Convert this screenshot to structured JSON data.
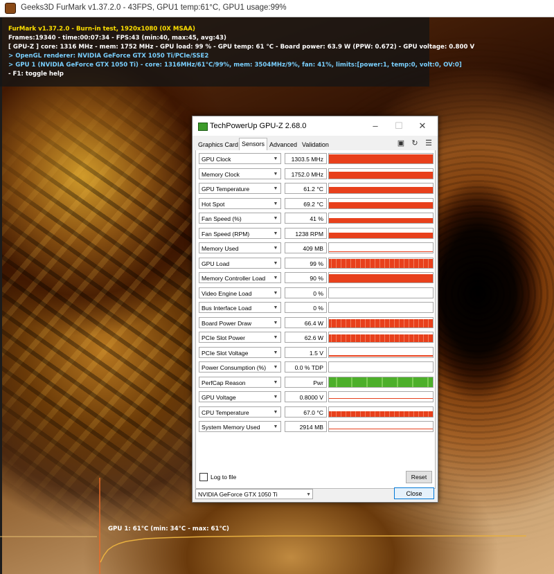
{
  "furmark": {
    "window_title": "Geeks3D FurMark v1.37.2.0 - 43FPS, GPU1 temp:61°C, GPU1 usage:99%",
    "osd": [
      {
        "text": "FurMark v1.37.2.0 - Burn-in test, 1920x1080 (0X MSAA)",
        "color": "yellow"
      },
      {
        "text": "Frames:19340 - time:00:07:34 - FPS:43 (min:40, max:45, avg:43)",
        "color": "white"
      },
      {
        "text": "[ GPU-Z ] core: 1316 MHz - mem: 1752 MHz - GPU load: 99 % - GPU temp: 61 °C - Board power: 63.9 W (PPW: 0.672) - GPU voltage: 0.800 V",
        "color": "white"
      },
      {
        "text": "> OpenGL renderer: NVIDIA GeForce GTX 1050 Ti/PCIe/SSE2",
        "color": "cyan"
      },
      {
        "text": "> GPU 1 (NVIDIA GeForce GTX 1050 Ti) - core: 1316MHz/61°C/99%, mem: 3504MHz/9%, fan: 41%, limits:[power:1, temp:0, volt:0, OV:0]",
        "color": "cyan"
      },
      {
        "text": "- F1: toggle help",
        "color": "white"
      }
    ],
    "graph_label": "GPU 1: 61°C (min: 34°C - max: 61°C)"
  },
  "gpuz": {
    "title": "TechPowerUp GPU-Z 2.68.0",
    "tabs": [
      {
        "label": "Graphics Card",
        "active": false
      },
      {
        "label": "Sensors",
        "active": true
      },
      {
        "label": "Advanced",
        "active": false
      },
      {
        "label": "Validation",
        "active": false
      }
    ],
    "sensors": [
      {
        "name": "GPU Clock",
        "value": "1303.5 MHz",
        "level": 0.92,
        "color": "#e8401c",
        "style": "solid"
      },
      {
        "name": "Memory Clock",
        "value": "1752.0 MHz",
        "level": 0.72,
        "color": "#e8401c",
        "style": "solid"
      },
      {
        "name": "GPU Temperature",
        "value": "61.2 °C",
        "level": 0.62,
        "color": "#e8401c",
        "style": "solid"
      },
      {
        "name": "Hot Spot",
        "value": "69.2 °C",
        "level": 0.66,
        "color": "#e8401c",
        "style": "solid"
      },
      {
        "name": "Fan Speed (%)",
        "value": "41 %",
        "level": 0.5,
        "color": "#e8401c",
        "style": "solid"
      },
      {
        "name": "Fan Speed (RPM)",
        "value": "1238 RPM",
        "level": 0.55,
        "color": "#e8401c",
        "style": "solid"
      },
      {
        "name": "Memory Used",
        "value": "409 MB",
        "level": 0.1,
        "color": "#e8401c",
        "style": "line"
      },
      {
        "name": "GPU Load",
        "value": "99 %",
        "level": 0.95,
        "color": "#e8401c",
        "style": "noisy"
      },
      {
        "name": "Memory Controller Load",
        "value": "90 %",
        "level": 0.85,
        "color": "#e8401c",
        "style": "solid"
      },
      {
        "name": "Video Engine Load",
        "value": "0 %",
        "level": 0,
        "color": "#e8401c",
        "style": "none"
      },
      {
        "name": "Bus Interface Load",
        "value": "0 %",
        "level": 0,
        "color": "#e8401c",
        "style": "none"
      },
      {
        "name": "Board Power Draw",
        "value": "66.4 W",
        "level": 0.85,
        "color": "#e8401c",
        "style": "noisy"
      },
      {
        "name": "PCIe Slot Power",
        "value": "62.6 W",
        "level": 0.8,
        "color": "#e8401c",
        "style": "noisy"
      },
      {
        "name": "PCIe Slot Voltage",
        "value": "1.5 V",
        "level": 0.04,
        "color": "#e8401c",
        "style": "line"
      },
      {
        "name": "Power Consumption (%)",
        "value": "0.0 % TDP",
        "level": 0,
        "color": "#e8401c",
        "style": "none"
      },
      {
        "name": "PerfCap Reason",
        "value": "Pwr",
        "level": 1,
        "color": "#4caf2a",
        "style": "solid"
      },
      {
        "name": "GPU Voltage",
        "value": "0.8000 V",
        "level": 0.25,
        "color": "#e8401c",
        "style": "line"
      },
      {
        "name": "CPU Temperature",
        "value": "67.0 °C",
        "level": 0.6,
        "color": "#e8401c",
        "style": "noisy"
      },
      {
        "name": "System Memory Used",
        "value": "2914 MB",
        "level": 0.18,
        "color": "#e8401c",
        "style": "line"
      }
    ],
    "log_label": "Log to file",
    "reset_label": "Reset",
    "gpu_selected": "NVIDIA GeForce GTX 1050 Ti",
    "close_label": "Close"
  }
}
